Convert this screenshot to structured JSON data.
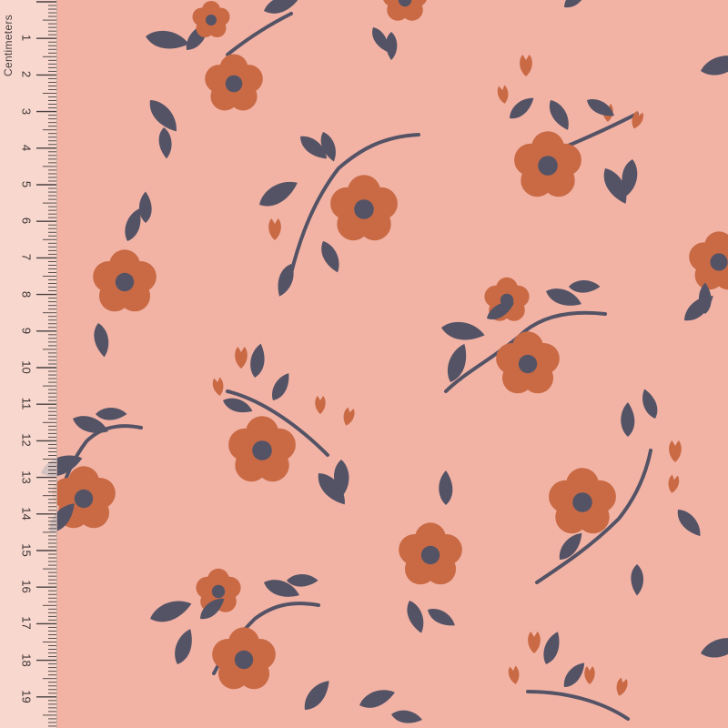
{
  "image": {
    "subject": "fabric-swatch",
    "background_color": "#f2b3a5",
    "flower_color": "#c96a45",
    "leaf_color": "#545366"
  },
  "ruler": {
    "label": "Centimeters",
    "numbers": [
      "1",
      "2",
      "3",
      "4",
      "5",
      "6",
      "7",
      "8",
      "9",
      "10",
      "11",
      "12",
      "13",
      "14",
      "15",
      "16",
      "17",
      "18",
      "19",
      "2"
    ]
  }
}
